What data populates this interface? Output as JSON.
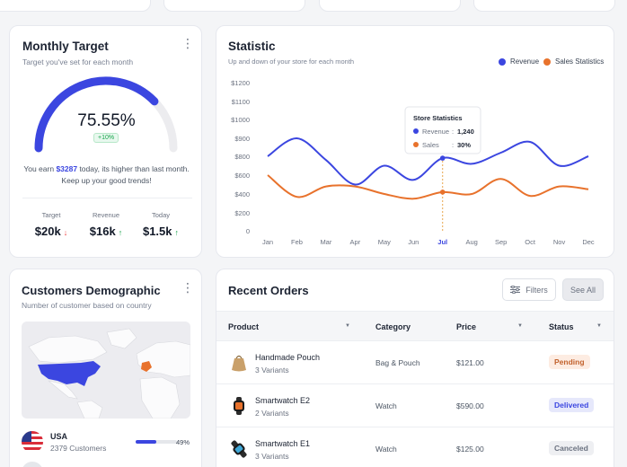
{
  "monthly_target": {
    "title": "Monthly Target",
    "subtitle": "Target you've set for each month",
    "progress_percent": 75.55,
    "percent_text": "75.55%",
    "change_badge": "+10%",
    "earn_prefix": "You earn ",
    "earn_amount": "$3287",
    "earn_suffix": " today, its higher than last month.",
    "earn_line2": "Keep up your good trends!",
    "kpis": [
      {
        "label": "Target",
        "value": "$20k",
        "trend": "down"
      },
      {
        "label": "Revenue",
        "value": "$16k",
        "trend": "up"
      },
      {
        "label": "Today",
        "value": "$1.5k",
        "trend": "up"
      }
    ],
    "colors": {
      "accent": "#3b46e0",
      "track": "#ececef"
    }
  },
  "statistic": {
    "title": "Statistic",
    "subtitle": "Up and down of your store for each month",
    "legend": [
      "Revenue",
      "Sales Statistics"
    ],
    "colors": {
      "revenue": "#3b46e0",
      "sales": "#e8722c"
    },
    "tooltip": {
      "title": "Store Statistics",
      "revenue_label": "Revenue",
      "revenue_value": "1,240",
      "sales_label": "Sales",
      "sales_value": "30%"
    }
  },
  "chart_data": {
    "type": "line",
    "categories": [
      "Jan",
      "Feb",
      "Mar",
      "Apr",
      "May",
      "Jun",
      "Jul",
      "Aug",
      "Sep",
      "Oct",
      "Nov",
      "Dec"
    ],
    "y_ticks": [
      "0",
      "$200",
      "$400",
      "$600",
      "$800",
      "$1000",
      "$1100",
      "$1200"
    ],
    "ylim": [
      0,
      1200
    ],
    "series": [
      {
        "name": "Revenue",
        "values": [
          800,
          900,
          760,
          500,
          700,
          550,
          780,
          720,
          820,
          880,
          700,
          800
        ]
      },
      {
        "name": "Sales Statistics",
        "values": [
          600,
          370,
          480,
          480,
          400,
          350,
          420,
          400,
          560,
          380,
          480,
          450
        ]
      }
    ],
    "highlight_category": "Jul",
    "legend_position": "top-right",
    "grid": false
  },
  "customers": {
    "title": "Customers Demographic",
    "subtitle": "Number of customer based on country",
    "countries": [
      {
        "name": "USA",
        "customers": "2379 Customers",
        "percent": 49,
        "percent_text": "49%"
      }
    ]
  },
  "orders": {
    "title": "Recent Orders",
    "filters_label": "Filters",
    "see_all_label": "See All",
    "columns": [
      "Product",
      "Category",
      "Price",
      "Status"
    ],
    "rows": [
      {
        "product": "Handmade Pouch",
        "variants": "3 Variants",
        "category": "Bag & Pouch",
        "price": "$121.00",
        "status": "Pending"
      },
      {
        "product": "Smartwatch E2",
        "variants": "2 Variants",
        "category": "Watch",
        "price": "$590.00",
        "status": "Delivered"
      },
      {
        "product": "Smartwatch E1",
        "variants": "3 Variants",
        "category": "Watch",
        "price": "$125.00",
        "status": "Canceled"
      }
    ],
    "status_colors": {
      "Pending": {
        "bg": "#fdece2",
        "fg": "#c2622d"
      },
      "Delivered": {
        "bg": "#e6e8fb",
        "fg": "#3b46e0"
      },
      "Canceled": {
        "bg": "#eeeff2",
        "fg": "#6b7280"
      }
    }
  }
}
